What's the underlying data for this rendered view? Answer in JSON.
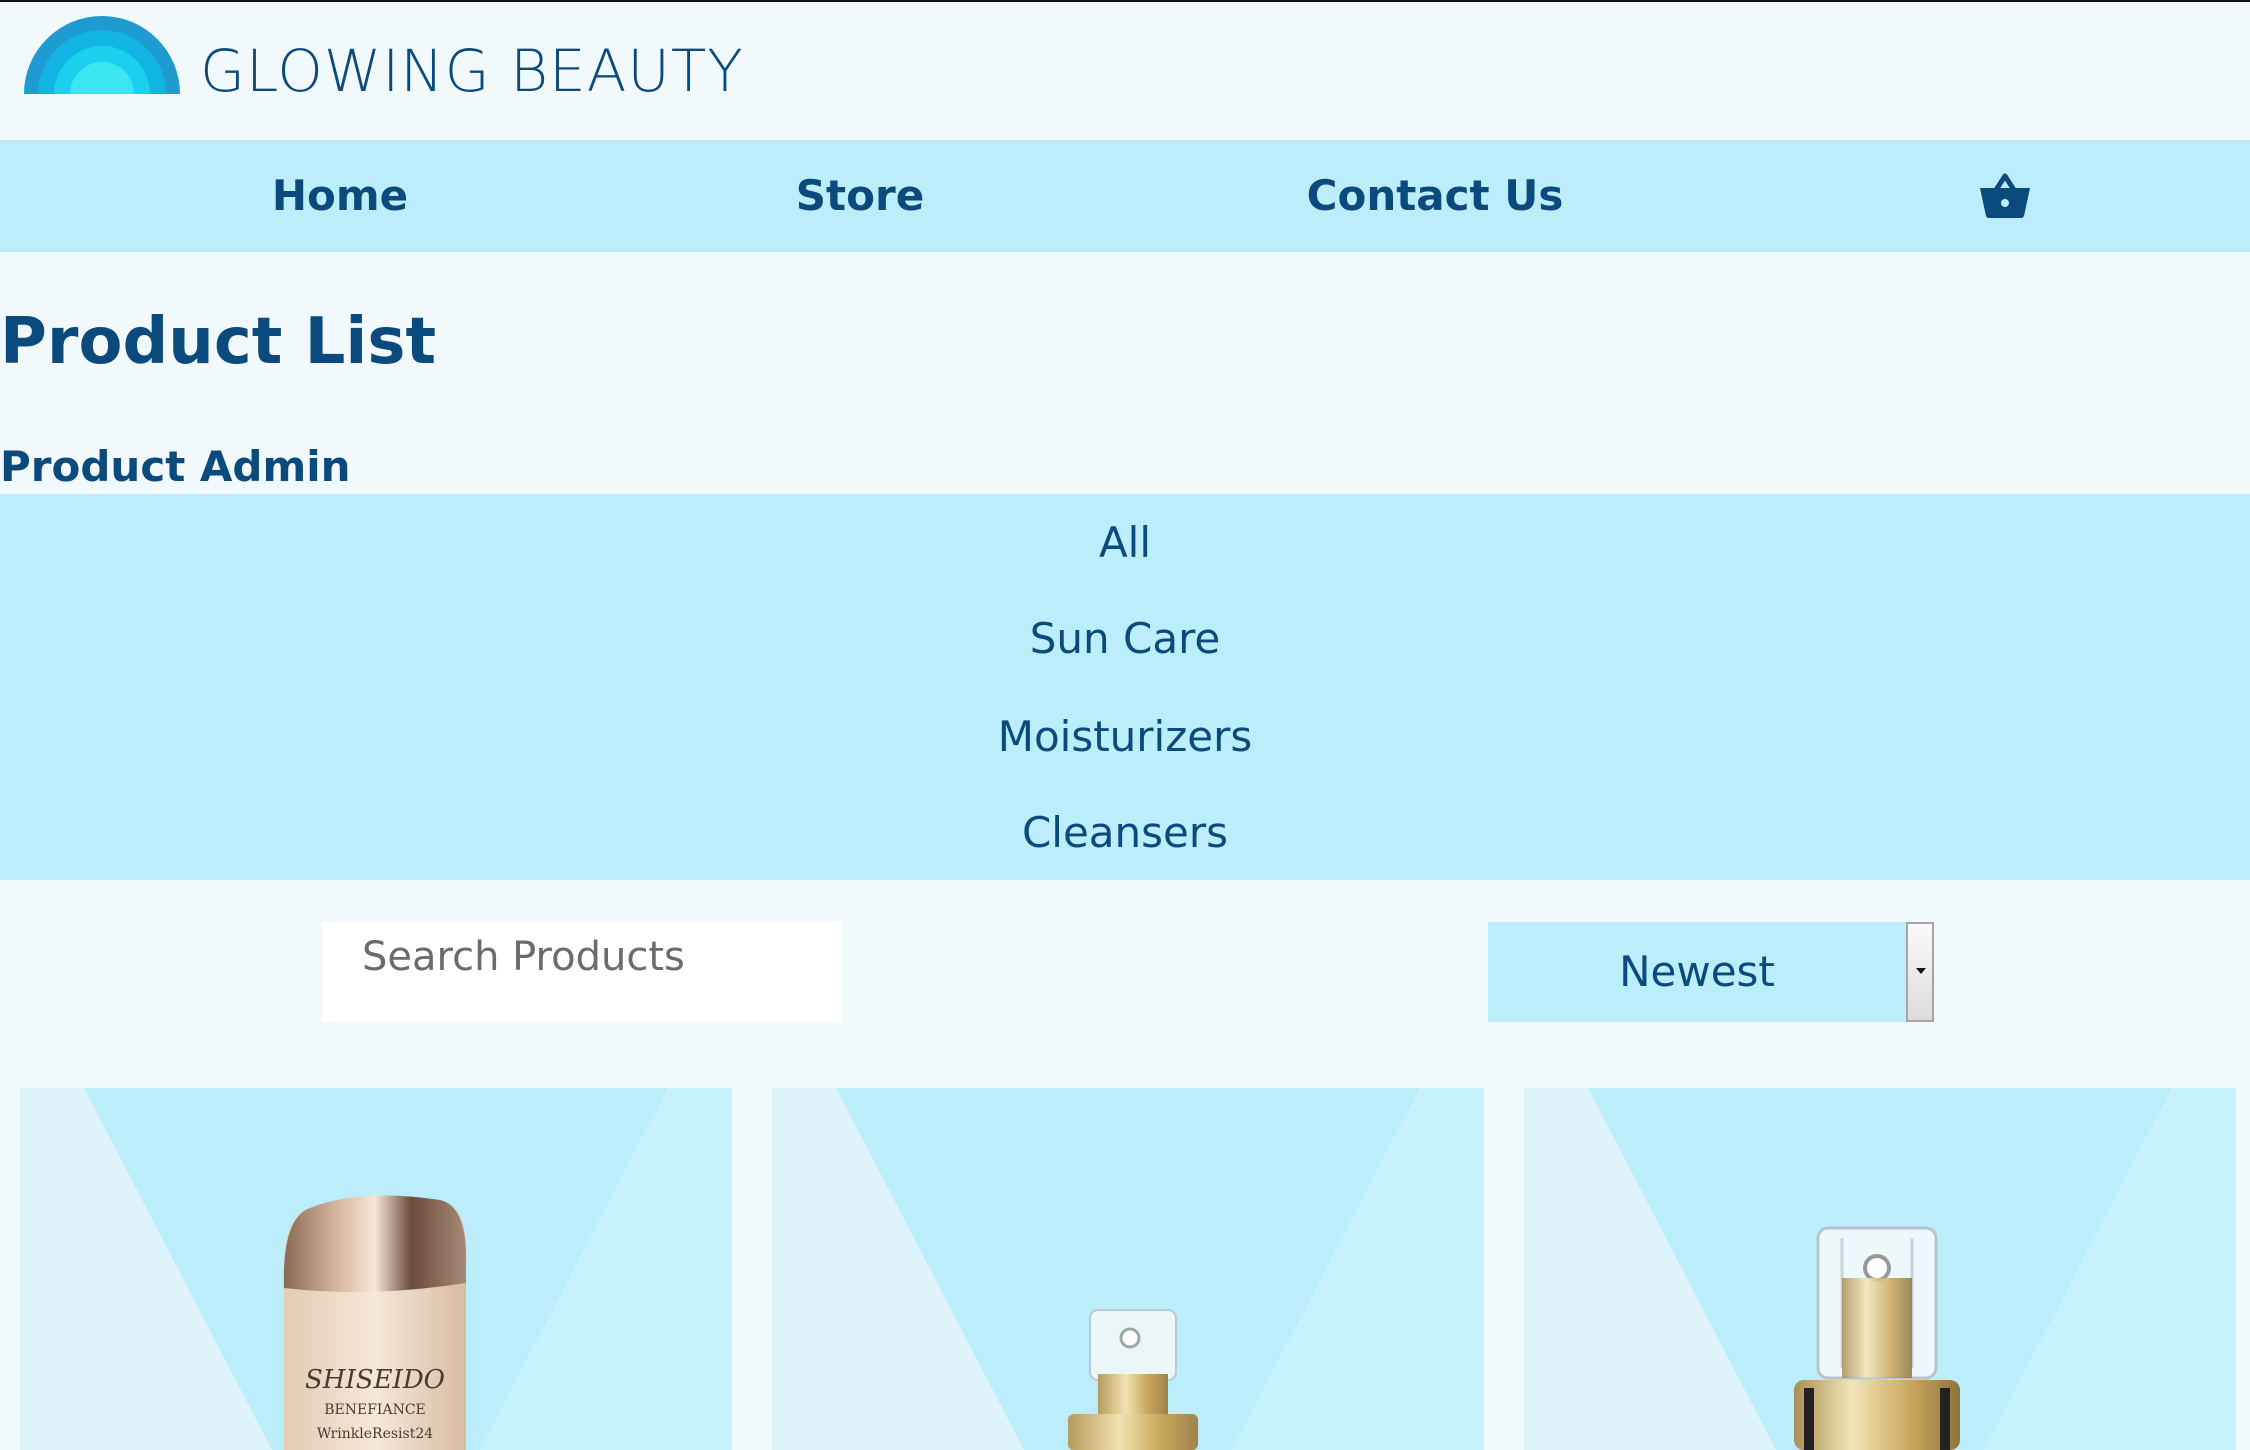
{
  "brand": {
    "name": "GLOWING BEAUTY",
    "colors": {
      "primary": "#0b4a7c",
      "band": "#bcedfb",
      "background": "#f2f9fd",
      "logo_outer": "#1e9bd0",
      "logo_mid": "#11c1e8",
      "logo_inner": "#3be5f2"
    }
  },
  "nav": {
    "items": [
      {
        "label": "Home"
      },
      {
        "label": "Store"
      },
      {
        "label": "Contact Us"
      }
    ],
    "cart_icon": "shopping-basket-icon"
  },
  "page": {
    "title": "Product List",
    "admin_link": "Product Admin"
  },
  "categories": [
    {
      "label": "All"
    },
    {
      "label": "Sun Care"
    },
    {
      "label": "Moisturizers"
    },
    {
      "label": "Cleansers"
    }
  ],
  "search": {
    "placeholder": "Search Products",
    "value": ""
  },
  "sort": {
    "selected": "Newest"
  },
  "products": [
    {
      "image": "cream-bottle-gold-cap",
      "brand_text": "SHISEIDO",
      "line_text": "BENEFIANCE",
      "sub_text": "WrinkleResist24"
    },
    {
      "image": "pump-bottle-small"
    },
    {
      "image": "pump-bottle-large"
    }
  ]
}
